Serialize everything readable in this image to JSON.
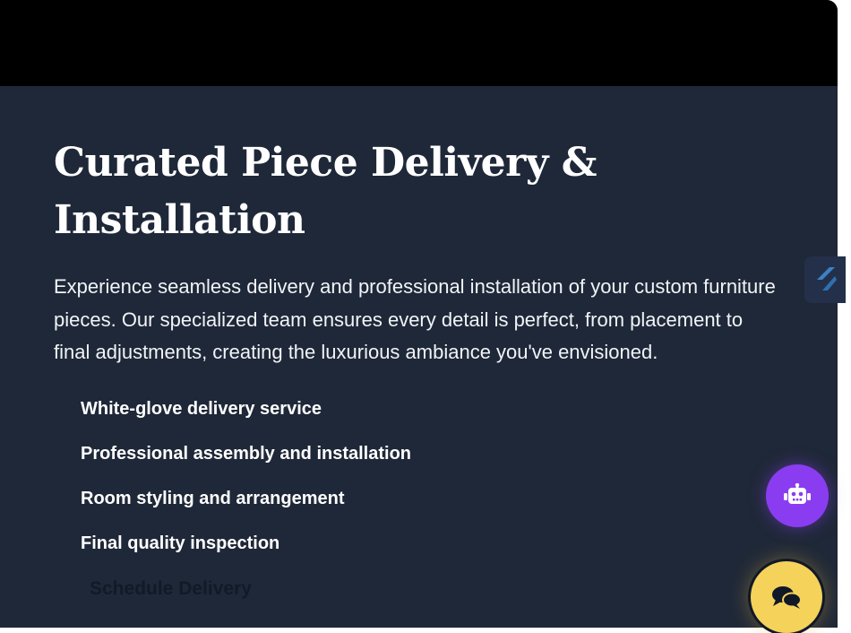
{
  "header": {
    "title": "Curated Piece Delivery & Installation"
  },
  "intro": {
    "text": "Experience seamless delivery and professional installation of your custom furniture pieces. Our specialized team ensures every detail is perfect, from placement to final adjustments, creating the luxurious ambiance you've envisioned."
  },
  "features": [
    "White-glove delivery service",
    "Professional assembly and installation",
    "Room styling and arrangement",
    "Final quality inspection"
  ],
  "cta": {
    "label": "Schedule Delivery"
  },
  "widgets": {
    "side_icon": "stack-icon",
    "bot_icon": "robot-icon",
    "chat_icon": "chat-bubbles-icon",
    "bot_color": "#8a3df0",
    "chat_color": "#f5d25a"
  },
  "colors": {
    "background": "#1f2838",
    "top_bar": "#000000",
    "text": "#ffffff"
  }
}
